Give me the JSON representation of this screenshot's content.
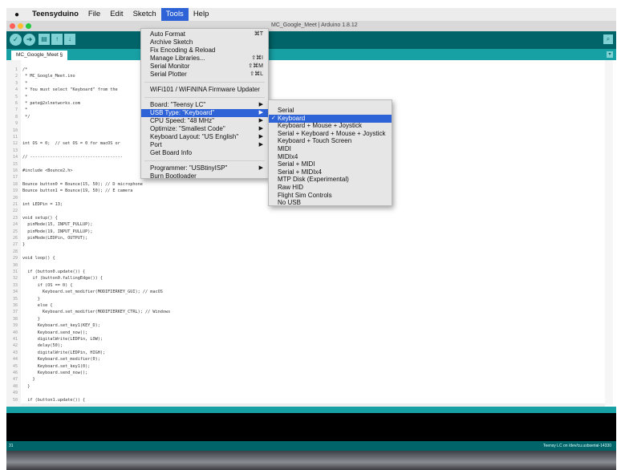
{
  "menubar": {
    "apple_icon": "apple-icon",
    "app_name": "Teensyduino",
    "items": [
      "File",
      "Edit",
      "Sketch",
      "Tools",
      "Help"
    ],
    "active_item": "Tools"
  },
  "window": {
    "title": "MC_Google_Meet | Arduino 1.8.12",
    "traffic_colors": [
      "#ff5f57",
      "#febc2e",
      "#28c840"
    ]
  },
  "toolbar": {
    "buttons": [
      {
        "name": "verify",
        "icon": "checkmark-icon",
        "glyph": "✓"
      },
      {
        "name": "upload",
        "icon": "arrow-right-icon",
        "glyph": "➜"
      },
      {
        "name": "new",
        "icon": "new-file-icon",
        "glyph": "▤"
      },
      {
        "name": "open",
        "icon": "open-arrow-up-icon",
        "glyph": "↑"
      },
      {
        "name": "save",
        "icon": "save-arrow-down-icon",
        "glyph": "↓"
      }
    ],
    "serial_monitor_icon": "magnifier-icon",
    "serial_glyph": "⌕",
    "accent": "#006468"
  },
  "tab": {
    "label": "MC_Google_Meet §",
    "menu_glyph": "▾"
  },
  "editor": {
    "lines": [
      {
        "n": "1",
        "t": "/*"
      },
      {
        "n": "2",
        "t": " * MC_Google_Meet.ino"
      },
      {
        "n": "3",
        "t": " *"
      },
      {
        "n": "4",
        "t": " * You must select \"Keyboard\" from the"
      },
      {
        "n": "5",
        "t": " *"
      },
      {
        "n": "6",
        "t": " * pete@2xlnetworks.com"
      },
      {
        "n": "7",
        "t": " *"
      },
      {
        "n": "8",
        "t": " */"
      },
      {
        "n": "9",
        "t": ""
      },
      {
        "n": "10",
        "t": ""
      },
      {
        "n": "11",
        "t": ""
      },
      {
        "n": "12",
        "t": "int OS = 0;  // set OS = 0 for macOS or"
      },
      {
        "n": "13",
        "t": ""
      },
      {
        "n": "14",
        "t": "// -------------------------------------"
      },
      {
        "n": "15",
        "t": ""
      },
      {
        "n": "16",
        "t": "#include <Bounce2.h>"
      },
      {
        "n": "17",
        "t": ""
      },
      {
        "n": "18",
        "t": "Bounce button0 = Bounce(15, 50); // D microphone"
      },
      {
        "n": "19",
        "t": "Bounce button1 = Bounce(19, 50); // E camera"
      },
      {
        "n": "20",
        "t": ""
      },
      {
        "n": "21",
        "t": "int LEDPin = 13;"
      },
      {
        "n": "22",
        "t": ""
      },
      {
        "n": "23",
        "t": "void setup() {"
      },
      {
        "n": "24",
        "t": "  pinMode(15, INPUT_PULLUP);"
      },
      {
        "n": "25",
        "t": "  pinMode(19, INPUT_PULLUP);"
      },
      {
        "n": "26",
        "t": "  pinMode(LEDPin, OUTPUT);"
      },
      {
        "n": "27",
        "t": "}"
      },
      {
        "n": "28",
        "t": ""
      },
      {
        "n": "29",
        "t": "void loop() {"
      },
      {
        "n": "30",
        "t": ""
      },
      {
        "n": "31",
        "t": "  if (button0.update()) {"
      },
      {
        "n": "32",
        "t": "    if (button0.fallingEdge()) {"
      },
      {
        "n": "33",
        "t": "      if (OS == 0) {"
      },
      {
        "n": "34",
        "t": "        Keyboard.set_modifier(MODIFIERKEY_GUI); // macOS"
      },
      {
        "n": "35",
        "t": "      }"
      },
      {
        "n": "36",
        "t": "      else {"
      },
      {
        "n": "37",
        "t": "        Keyboard.set_modifier(MODIFIERKEY_CTRL); // Windows"
      },
      {
        "n": "38",
        "t": "      }"
      },
      {
        "n": "39",
        "t": "      Keyboard.set_key1(KEY_D);"
      },
      {
        "n": "40",
        "t": "      Keyboard.send_now();"
      },
      {
        "n": "41",
        "t": "      digitalWrite(LEDPin, LOW);"
      },
      {
        "n": "42",
        "t": "      delay(50);"
      },
      {
        "n": "43",
        "t": "      digitalWrite(LEDPin, HIGH);"
      },
      {
        "n": "44",
        "t": "      Keyboard.set_modifier(0);"
      },
      {
        "n": "45",
        "t": "      Keyboard.set_key1(0);"
      },
      {
        "n": "46",
        "t": "      Keyboard.send_now();"
      },
      {
        "n": "47",
        "t": "    }"
      },
      {
        "n": "48",
        "t": "  }"
      },
      {
        "n": "49",
        "t": ""
      },
      {
        "n": "50",
        "t": "  if (button1.update()) {"
      }
    ]
  },
  "tools_menu": {
    "items": [
      {
        "label": "Auto Format",
        "shortcut": "⌘T"
      },
      {
        "label": "Archive Sketch",
        "shortcut": ""
      },
      {
        "label": "Fix Encoding & Reload",
        "shortcut": ""
      },
      {
        "label": "Manage Libraries...",
        "shortcut": "⇧⌘I"
      },
      {
        "label": "Serial Monitor",
        "shortcut": "⇧⌘M"
      },
      {
        "label": "Serial Plotter",
        "shortcut": "⇧⌘L"
      },
      {
        "label": "WiFi101 / WiFiNINA Firmware Updater",
        "shortcut": ""
      },
      {
        "label": "Board: \"Teensy LC\"",
        "shortcut": ""
      },
      {
        "label": "USB Type: \"Keyboard\"",
        "shortcut": ""
      },
      {
        "label": "CPU Speed: \"48 MHz\"",
        "shortcut": ""
      },
      {
        "label": "Optimize: \"Smallest Code\"",
        "shortcut": ""
      },
      {
        "label": "Keyboard Layout: \"US English\"",
        "shortcut": ""
      },
      {
        "label": "Port",
        "shortcut": ""
      },
      {
        "label": "Get Board Info",
        "shortcut": ""
      },
      {
        "label": "Programmer: \"USBtinyISP\"",
        "shortcut": ""
      },
      {
        "label": "Burn Bootloader",
        "shortcut": ""
      }
    ],
    "submenu_arrow": "▶",
    "highlight_color": "#2d63d6"
  },
  "usb_menu": {
    "items": [
      "Serial",
      "Keyboard",
      "Keyboard + Mouse + Joystick",
      "Serial + Keyboard + Mouse + Joystick",
      "Keyboard + Touch Screen",
      "MIDI",
      "MIDIx4",
      "Serial + MIDI",
      "Serial + MIDIx4",
      "MTP Disk (Experimental)",
      "Raw HID",
      "Flight Sim Controls",
      "No USB"
    ],
    "selected": "Keyboard",
    "check_glyph": "✓"
  },
  "status": {
    "line_number": "31",
    "board_port": "Teensy LC on /dev/cu.usbserial-14330"
  }
}
